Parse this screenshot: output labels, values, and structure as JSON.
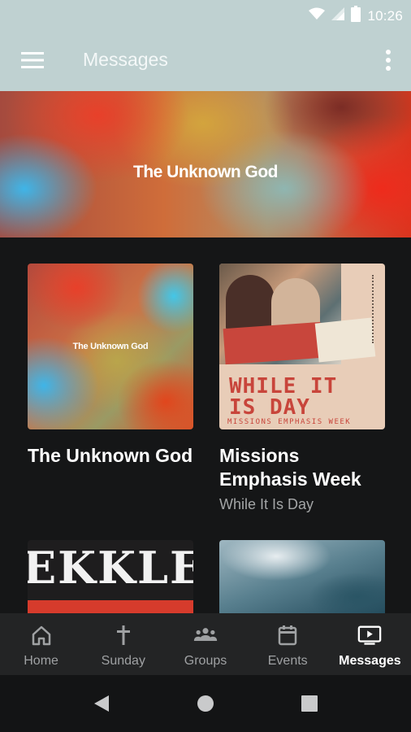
{
  "status_bar": {
    "time": "10:26"
  },
  "app_bar": {
    "title": "Messages"
  },
  "hero": {
    "title": "The Unknown God"
  },
  "series": [
    {
      "title": "The Unknown God",
      "subtitle": "",
      "thumb_text": "The Unknown God"
    },
    {
      "title": "Missions Emphasis Week",
      "subtitle": "While It Is Day",
      "thumb_line1": "WHILE IT",
      "thumb_line2": "IS DAY",
      "thumb_sub": "MISSIONS EMPHASIS WEEK"
    },
    {
      "title": "",
      "thumb_text": "EKKLE"
    },
    {
      "title": ""
    }
  ],
  "bottom_nav": [
    {
      "label": "Home",
      "icon": "home-icon"
    },
    {
      "label": "Sunday",
      "icon": "cross-icon"
    },
    {
      "label": "Groups",
      "icon": "groups-icon"
    },
    {
      "label": "Events",
      "icon": "calendar-icon"
    },
    {
      "label": "Messages",
      "icon": "tv-icon",
      "active": true
    }
  ],
  "colors": {
    "app_bar": "#bfd1d1",
    "background": "#151617",
    "nav": "#232425",
    "active_label": "#ffffff",
    "inactive_label": "#9fa1a3"
  }
}
